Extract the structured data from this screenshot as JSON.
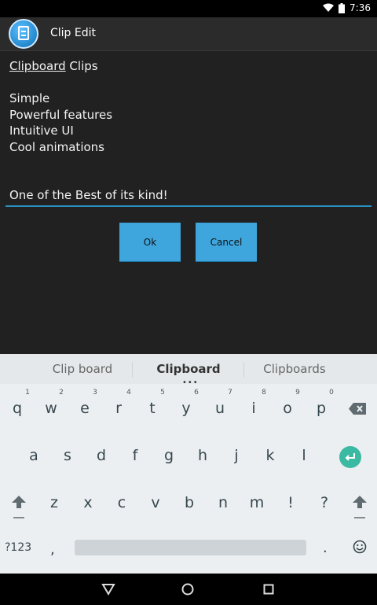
{
  "status_bar": {
    "time": "7:36",
    "wifi_icon": "wifi-icon",
    "battery_icon": "battery-icon"
  },
  "action_bar": {
    "title": "Clip Edit",
    "app_icon": "clipboard-document-icon"
  },
  "editor": {
    "heading_underlined": "Clipboard",
    "heading_rest": " Clips",
    "lines": [
      "Simple",
      "Powerful features",
      "Intuitive UI",
      "Cool animations"
    ],
    "tagline": "One of the Best of its kind!"
  },
  "buttons": {
    "ok": "Ok",
    "cancel": "Cancel"
  },
  "keyboard": {
    "suggestions": [
      "Clip board",
      "Clipboard",
      "Clipboards"
    ],
    "dots": "•••",
    "row1": [
      "q",
      "w",
      "e",
      "r",
      "t",
      "y",
      "u",
      "i",
      "o",
      "p"
    ],
    "row1_hints": [
      "1",
      "2",
      "3",
      "4",
      "5",
      "6",
      "7",
      "8",
      "9",
      "0"
    ],
    "row2": [
      "a",
      "s",
      "d",
      "f",
      "g",
      "h",
      "j",
      "k",
      "l"
    ],
    "row3": [
      "z",
      "x",
      "c",
      "v",
      "b",
      "n",
      "m",
      "!",
      "?"
    ],
    "symbols_key": "?123",
    "comma_key": ",",
    "period_key": ".",
    "backspace_icon": "backspace-icon",
    "enter_icon": "enter-icon",
    "shift_icon": "shift-icon",
    "emoji_icon": "emoji-icon",
    "accent_color": "#3cb9a2"
  },
  "nav_bar": {
    "back_icon": "back-triangle-icon",
    "home_icon": "home-circle-icon",
    "recents_icon": "recents-square-icon"
  }
}
